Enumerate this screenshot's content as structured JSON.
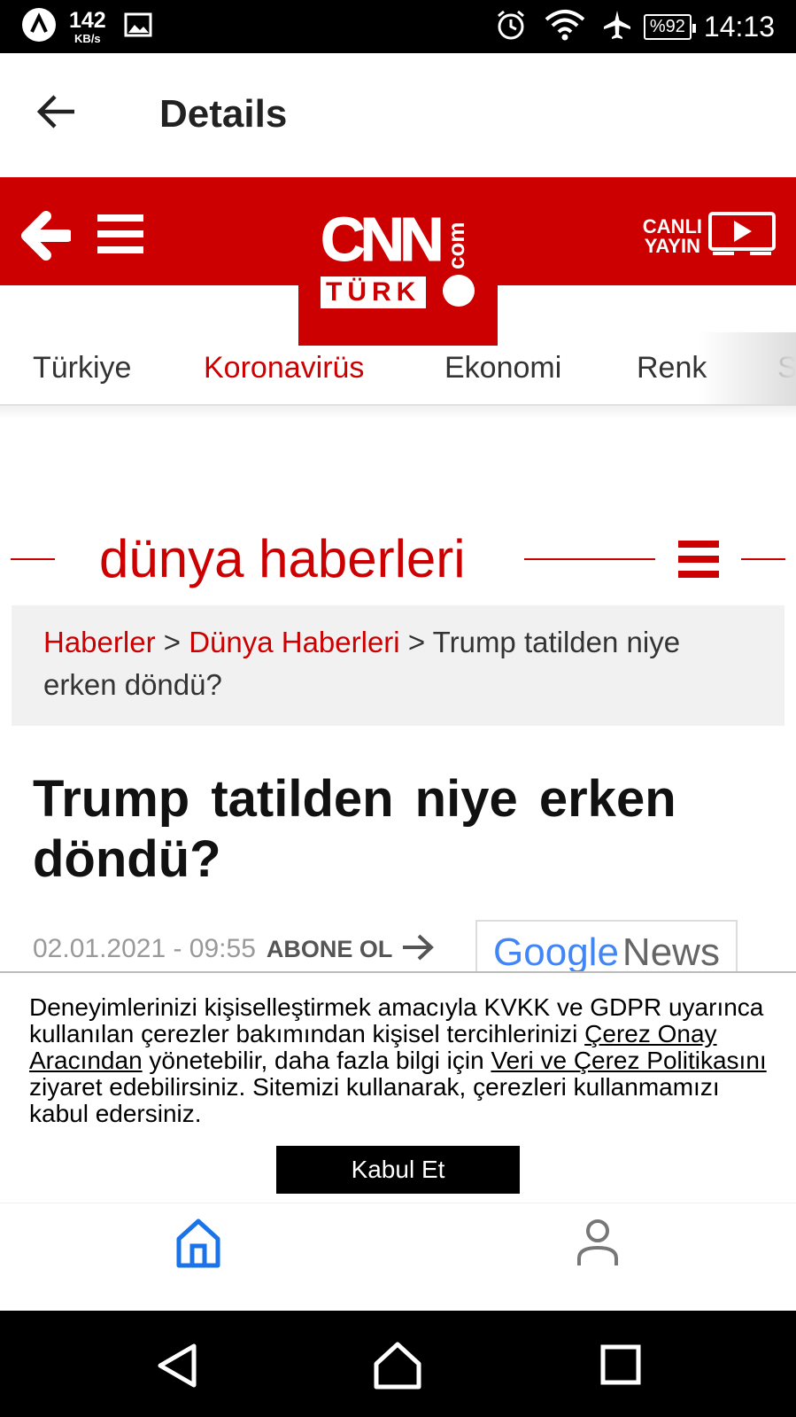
{
  "status_bar": {
    "speed_value": "142",
    "speed_unit": "KB/s",
    "battery": "%92",
    "time": "14:13"
  },
  "app_bar": {
    "title": "Details"
  },
  "site_header": {
    "logo_main": "CNN",
    "logo_com": "com",
    "logo_turk": "TÜRK",
    "live_line1": "CANLI",
    "live_line2": "YAYIN",
    "brand_color": "#cc0000"
  },
  "tabs": [
    "Türkiye",
    "Koronavirüs",
    "Ekonomi",
    "Renk",
    "S"
  ],
  "active_tab": "Koronavirüs",
  "section": {
    "title": "dünya haberleri"
  },
  "breadcrumb": {
    "item1": "Haberler",
    "sep": ">",
    "item2": "Dünya Haberleri",
    "current": "Trump tatilden niye erken döndü?"
  },
  "article": {
    "headline": "Trump tatilden niye erken döndü?",
    "date": "02.01.2021 - 09:55",
    "subscribe": "ABONE OL",
    "google_news": {
      "part1": "Google",
      "part2": "News"
    }
  },
  "cookie": {
    "text_a": "Deneyimlerinizi kişiselleştirmek amacıyla KVKK ve GDPR uyarınca kullanılan çerezler bakımından kişisel tercihlerinizi ",
    "link1": "Çerez Onay Aracından",
    "text_b": " yönetebilir, daha fazla bilgi için ",
    "link2": "Veri ve Çerez Politikasını",
    "text_c": " ziyaret edebilirsiniz. Sitemizi kullanarak, çerezleri kullanmamızı kabul edersiniz.",
    "button": "Kabul Et"
  },
  "bottom_nav": {
    "active_color": "#1a73e8",
    "items": [
      "home-icon",
      "profile-icon"
    ]
  },
  "system_nav": [
    "back-triangle-icon",
    "home-outline-icon",
    "recents-square-icon"
  ]
}
